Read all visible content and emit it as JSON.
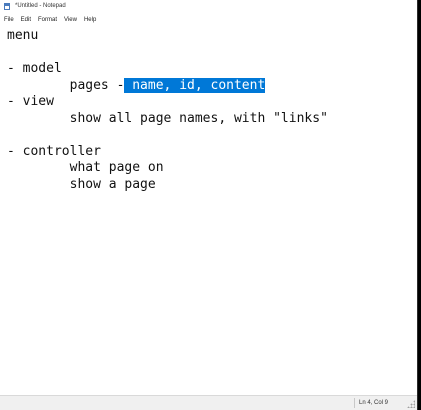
{
  "window": {
    "title": "*Untitled - Notepad"
  },
  "menu": {
    "items": [
      "File",
      "Edit",
      "Format",
      "View",
      "Help"
    ]
  },
  "editor": {
    "lines": [
      {
        "text": "menu"
      },
      {
        "text": ""
      },
      {
        "text": "- model"
      },
      {
        "text": "        pages -",
        "selected": " name, id, content"
      },
      {
        "text": "- view"
      },
      {
        "text": "        show all page names, with \"links\""
      },
      {
        "text": ""
      },
      {
        "text": "- controller"
      },
      {
        "text": "        what page on"
      },
      {
        "text": "        show a page"
      }
    ]
  },
  "status": {
    "cursor_position": "Ln 4, Col 9"
  },
  "colors": {
    "selection": "#0078d7",
    "text": "#111111",
    "background": "#ffffff"
  }
}
